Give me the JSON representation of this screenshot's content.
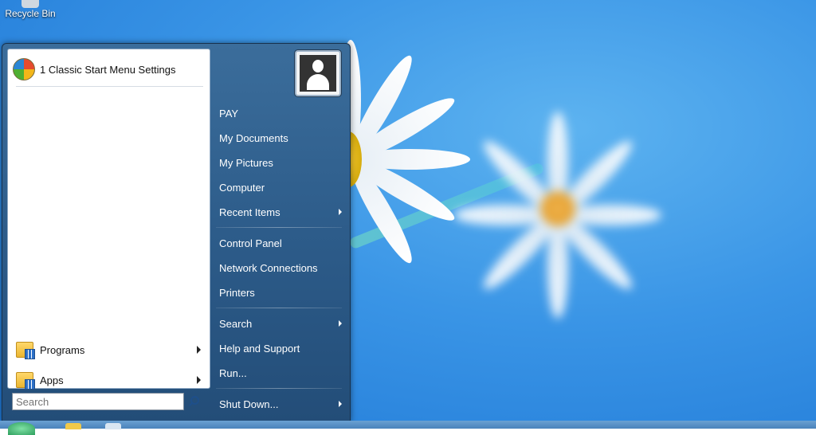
{
  "desktop": {
    "recycle_bin_label": "Recycle Bin"
  },
  "start_menu": {
    "pinned": [
      {
        "label": "1 Classic Start Menu Settings",
        "icon": "classic-shell-icon"
      }
    ],
    "left_items": [
      {
        "label": "Programs",
        "icon": "programs-folder-icon",
        "has_submenu": true
      },
      {
        "label": "Apps",
        "icon": "apps-folder-icon",
        "has_submenu": true
      }
    ],
    "search": {
      "placeholder": "Search"
    },
    "right_items": [
      {
        "label": "PAY"
      },
      {
        "label": "My Documents"
      },
      {
        "label": "My Pictures"
      },
      {
        "label": "Computer"
      },
      {
        "label": "Recent Items",
        "has_submenu": true
      },
      {
        "label": "Control Panel"
      },
      {
        "label": "Network Connections"
      },
      {
        "label": "Printers"
      },
      {
        "label": "Search",
        "has_submenu": true
      },
      {
        "label": "Help and Support"
      },
      {
        "label": "Run..."
      },
      {
        "label": "Shut Down...",
        "has_submenu": true
      }
    ]
  },
  "colors": {
    "menu_right_bg": "#2d5c8a",
    "desktop_bg": "#3a95e6"
  }
}
